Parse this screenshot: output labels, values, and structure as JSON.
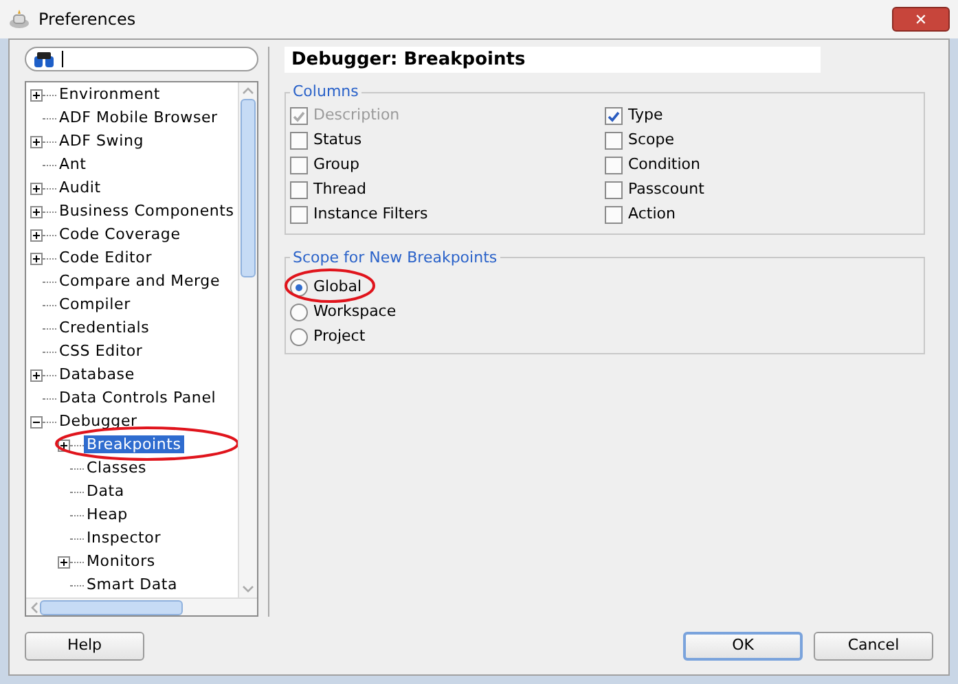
{
  "window": {
    "title": "Preferences",
    "close": "✕"
  },
  "tree": [
    {
      "label": "Environment",
      "kind": "branch",
      "expanded": false,
      "selected": false,
      "circled": false
    },
    {
      "label": "ADF Mobile Browser",
      "kind": "leaf",
      "selected": false,
      "circled": false
    },
    {
      "label": "ADF Swing",
      "kind": "branch",
      "expanded": false,
      "selected": false,
      "circled": false
    },
    {
      "label": "Ant",
      "kind": "leaf",
      "selected": false,
      "circled": false
    },
    {
      "label": "Audit",
      "kind": "branch",
      "expanded": false,
      "selected": false,
      "circled": false
    },
    {
      "label": "Business Components",
      "kind": "branch",
      "expanded": false,
      "selected": false,
      "circled": false
    },
    {
      "label": "Code Coverage",
      "kind": "branch",
      "expanded": false,
      "selected": false,
      "circled": false
    },
    {
      "label": "Code Editor",
      "kind": "branch",
      "expanded": false,
      "selected": false,
      "circled": false
    },
    {
      "label": "Compare and Merge",
      "kind": "leaf",
      "selected": false,
      "circled": false
    },
    {
      "label": "Compiler",
      "kind": "leaf",
      "selected": false,
      "circled": false
    },
    {
      "label": "Credentials",
      "kind": "leaf",
      "selected": false,
      "circled": false
    },
    {
      "label": "CSS Editor",
      "kind": "leaf",
      "selected": false,
      "circled": false
    },
    {
      "label": "Database",
      "kind": "branch",
      "expanded": false,
      "selected": false,
      "circled": false
    },
    {
      "label": "Data Controls Panel",
      "kind": "leaf",
      "selected": false,
      "circled": false
    },
    {
      "label": "Debugger",
      "kind": "branch",
      "expanded": true,
      "selected": false,
      "circled": false,
      "children": [
        {
          "label": "Breakpoints",
          "kind": "branch",
          "expanded": false,
          "selected": true,
          "circled": true
        },
        {
          "label": "Classes",
          "kind": "leaf",
          "selected": false,
          "circled": false
        },
        {
          "label": "Data",
          "kind": "leaf",
          "selected": false,
          "circled": false
        },
        {
          "label": "Heap",
          "kind": "leaf",
          "selected": false,
          "circled": false
        },
        {
          "label": "Inspector",
          "kind": "leaf",
          "selected": false,
          "circled": false
        },
        {
          "label": "Monitors",
          "kind": "branch",
          "expanded": false,
          "selected": false,
          "circled": false
        },
        {
          "label": "Smart Data",
          "kind": "leaf",
          "selected": false,
          "circled": false
        }
      ]
    }
  ],
  "page_title": "Debugger: Breakpoints",
  "columns": {
    "legend": "Columns",
    "items": [
      {
        "label": "Description",
        "checked": true,
        "disabled": true
      },
      {
        "label": "Status",
        "checked": false,
        "disabled": false
      },
      {
        "label": "Group",
        "checked": false,
        "disabled": false
      },
      {
        "label": "Thread",
        "checked": false,
        "disabled": false
      },
      {
        "label": "Instance Filters",
        "checked": false,
        "disabled": false
      },
      {
        "label": "Type",
        "checked": true,
        "disabled": false
      },
      {
        "label": "Scope",
        "checked": false,
        "disabled": false
      },
      {
        "label": "Condition",
        "checked": false,
        "disabled": false
      },
      {
        "label": "Passcount",
        "checked": false,
        "disabled": false
      },
      {
        "label": "Action",
        "checked": false,
        "disabled": false
      }
    ]
  },
  "scope": {
    "legend": "Scope for New Breakpoints",
    "options": [
      {
        "label": "Global",
        "selected": true,
        "circled": true
      },
      {
        "label": "Workspace",
        "selected": false,
        "circled": false
      },
      {
        "label": "Project",
        "selected": false,
        "circled": false
      }
    ]
  },
  "buttons": [
    {
      "label": "Help",
      "default": false
    },
    {
      "label": "OK",
      "default": true
    },
    {
      "label": "Cancel",
      "default": false
    }
  ]
}
